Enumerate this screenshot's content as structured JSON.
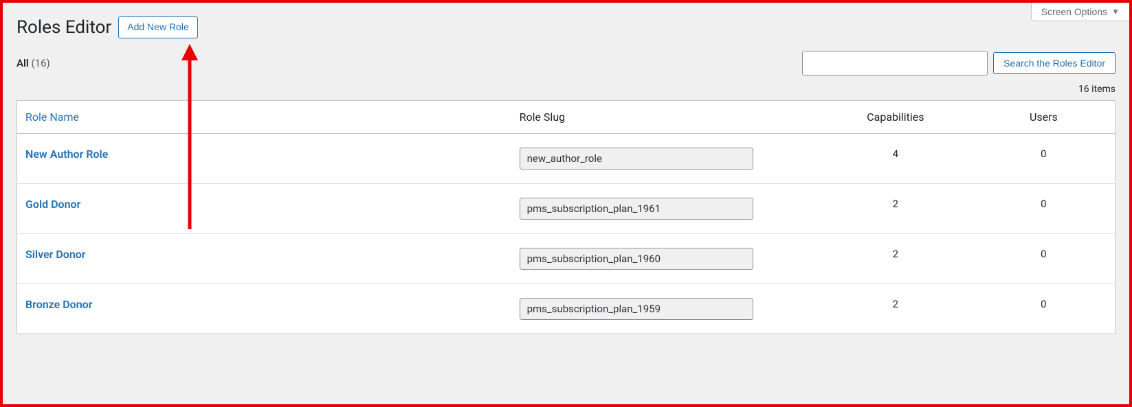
{
  "screen_options_label": "Screen Options",
  "page_title": "Roles Editor",
  "add_new_label": "Add New Role",
  "filter_all_label": "All",
  "filter_all_count": "(16)",
  "search_button_label": "Search the Roles Editor",
  "items_count_text": "16 items",
  "columns": {
    "name": "Role Name",
    "slug": "Role Slug",
    "caps": "Capabilities",
    "users": "Users"
  },
  "rows": [
    {
      "name": "New Author Role",
      "slug": "new_author_role",
      "caps": "4",
      "users": "0"
    },
    {
      "name": "Gold Donor",
      "slug": "pms_subscription_plan_1961",
      "caps": "2",
      "users": "0"
    },
    {
      "name": "Silver Donor",
      "slug": "pms_subscription_plan_1960",
      "caps": "2",
      "users": "0"
    },
    {
      "name": "Bronze Donor",
      "slug": "pms_subscription_plan_1959",
      "caps": "2",
      "users": "0"
    }
  ]
}
